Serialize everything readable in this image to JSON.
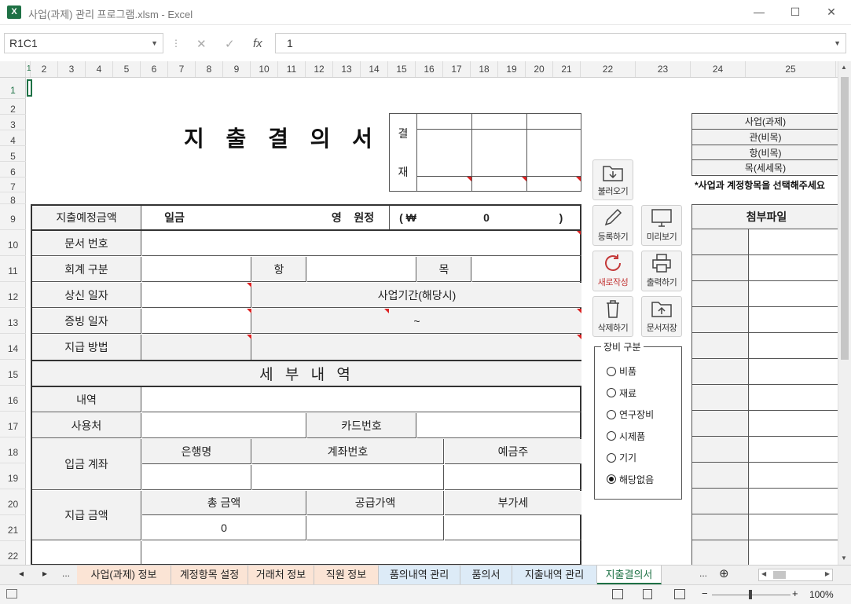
{
  "window": {
    "title": "사업(과제) 관리 프로그램.xlsm - Excel",
    "app_icon": "X",
    "minimize": "—",
    "maximize": "☐",
    "close": "✕"
  },
  "formula_bar": {
    "name_box": "R1C1",
    "cancel_icon": "✕",
    "enter_icon": "✓",
    "fx_icon": "fx",
    "formula": "1"
  },
  "column_headers": [
    "1",
    "2",
    "3",
    "4",
    "5",
    "6",
    "7",
    "8",
    "9",
    "10",
    "11",
    "12",
    "13",
    "14",
    "15",
    "16",
    "17",
    "18",
    "19",
    "20",
    "21",
    "22",
    "23",
    "24",
    "25"
  ],
  "row_headers": [
    "1",
    "2",
    "3",
    "4",
    "5",
    "6",
    "7",
    "8",
    "9",
    "10",
    "11",
    "12",
    "13",
    "14",
    "15",
    "16",
    "17",
    "18",
    "19",
    "20",
    "21",
    "22"
  ],
  "form": {
    "title": "지 출 결 의 서",
    "approval": {
      "gyeol": "결",
      "jae": "재"
    },
    "right_panel": [
      "사업(과제)",
      "관(비목)",
      "항(비목)",
      "목(세세목)"
    ],
    "right_note": "*사업과 계정항목을 선택해주세요",
    "attach_header": "첨부파일",
    "amount_label": "지출예정금액",
    "amount_il": "일금",
    "amount_won": "영    원정",
    "amount_paren_open": "( ₩",
    "amount_value": "0",
    "amount_paren_close": ")",
    "doc_no_label": "문서 번호",
    "account_label": "회계 구분",
    "hang_label": "항",
    "mok_label": "목",
    "submit_date_label": "상신 일자",
    "period_label": "사업기간(해당시)",
    "proof_date_label": "증빙 일자",
    "tilde": "~",
    "pay_method_label": "지급 방법",
    "details_header": "세 부 내 역",
    "desc_label": "내역",
    "vendor_label": "사용처",
    "card_label": "카드번호",
    "bank_account_label": "입금 계좌",
    "bank_name_label": "은행명",
    "account_no_label": "계좌번호",
    "holder_label": "예금주",
    "pay_amount_label": "지급 금액",
    "total_label": "총 금액",
    "supply_label": "공급가액",
    "vat_label": "부가세",
    "total_value": "0"
  },
  "buttons": {
    "load": "불러오기",
    "register": "등록하기",
    "preview": "미리보기",
    "new": "새로작성",
    "print": "출력하기",
    "delete": "삭제하기",
    "save": "문서저장"
  },
  "equipment": {
    "legend": "장비 구분",
    "options": [
      "비품",
      "재료",
      "연구장비",
      "시제품",
      "기기",
      "해당없음"
    ],
    "selected": "해당없음"
  },
  "tabs": {
    "nav_prev": "◂",
    "nav_next": "▸",
    "ellipsis_left": "...",
    "items": [
      "사업(과제) 정보",
      "계정항목 설정",
      "거래처 정보",
      "직원 정보",
      "품의내역 관리",
      "품의서",
      "지출내역 관리",
      "지출결의서"
    ],
    "ellipsis_right": "...",
    "add": "⊕"
  },
  "statusbar": {
    "zoom": "100%",
    "zoom_minus": "−",
    "zoom_plus": "+"
  }
}
